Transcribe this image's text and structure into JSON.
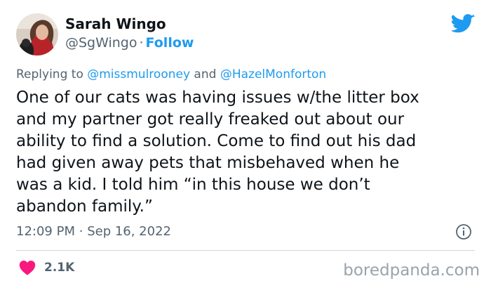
{
  "author": {
    "name": "Sarah Wingo",
    "handle": "@SgWingo",
    "separator": "·",
    "follow_label": "Follow"
  },
  "reply": {
    "prefix": "Replying to ",
    "mention_1": "@missmulrooney",
    "joiner": " and ",
    "mention_2": "@HazelMonforton"
  },
  "tweet": {
    "text": "One of our cats was having issues w/the litter box\nand my partner got really freaked out about our\nability to find a solution. Come to find out his dad\nhad given away pets that misbehaved when he\nwas a kid. I told him “in this house we don’t\nabandon family.”",
    "time": "12:09 PM",
    "separator": "·",
    "date": "Sep 16, 2022",
    "like_count": "2.1K"
  },
  "icons": {
    "platform": "twitter-bird-icon",
    "info": "info-icon",
    "like": "heart-icon"
  },
  "colors": {
    "accent": "#1d9bf0",
    "like": "#f91880",
    "secondary_text": "#536471",
    "divider": "#cfd9de"
  },
  "watermark": "boredpanda.com"
}
